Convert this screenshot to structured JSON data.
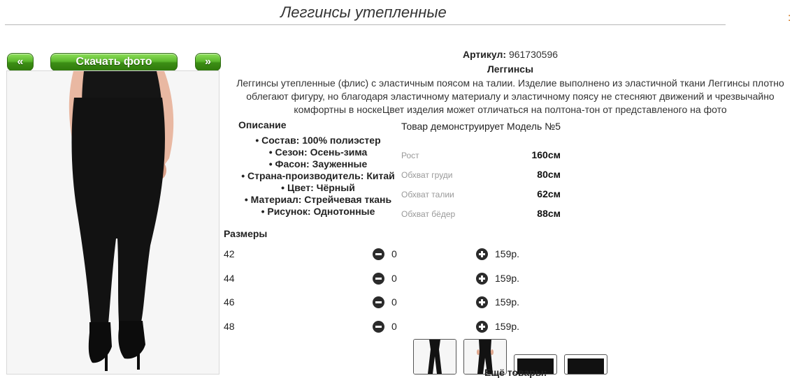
{
  "product": {
    "title": "Леггинсы утепленные",
    "article_label": "Артикул:",
    "article": "961730596",
    "kind": "Леггинсы",
    "description": "Леггинсы утепленные (флис) с эластичным поясом на талии. Изделие выполнено из эластичной ткани Леггинсы плотно облегают фигуру, но благодаря эластичному материалу и эластичному поясу не стесняют движений и чрезвычайно комфортны в носкеЦвет изделия может отличаться на полтона-тон от представленого на фото"
  },
  "gallery": {
    "prev_label": "«",
    "next_label": "»",
    "download_label": "Скачать фото"
  },
  "specs": {
    "title": "Описание",
    "items": [
      "Состав: 100% полиэстер",
      "Сезон: Осень-зима",
      "Фасон: Зауженные",
      "Страна-производитель: Китай",
      "Цвет: Чёрный",
      "Материал: Стрейчевая ткань",
      "Рисунок: Однотонные"
    ]
  },
  "model": {
    "title": "Товар демонструирует Модель №5",
    "measures": [
      {
        "label": "Рост",
        "value": "160см"
      },
      {
        "label": "Обхват груди",
        "value": "80см"
      },
      {
        "label": "Обхват талии",
        "value": "62см"
      },
      {
        "label": "Обхват бёдер",
        "value": "88см"
      }
    ]
  },
  "sizes": {
    "title": "Размеры",
    "rows": [
      {
        "size": "42",
        "qty": "0",
        "price": "159р."
      },
      {
        "size": "44",
        "qty": "0",
        "price": "159р."
      },
      {
        "size": "46",
        "qty": "0",
        "price": "159р."
      },
      {
        "size": "48",
        "qty": "0",
        "price": "159р."
      }
    ]
  },
  "more_label": "Ещё товары:",
  "edge_mark": ":"
}
